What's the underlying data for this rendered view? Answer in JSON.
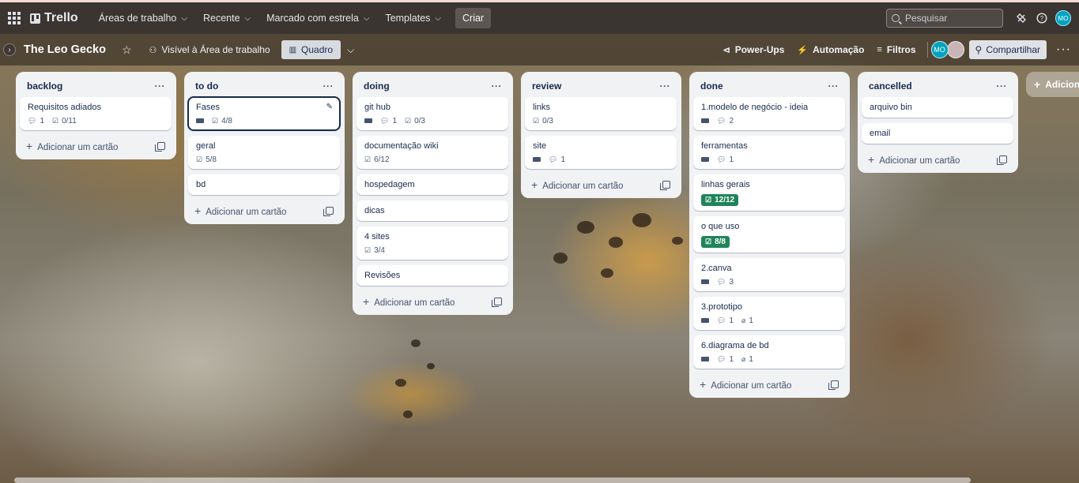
{
  "topbar": {
    "logo": "Trello",
    "menus": [
      "Áreas de trabalho",
      "Recente",
      "Marcado com estrela",
      "Templates"
    ],
    "create_label": "Criar",
    "search_placeholder": "Pesquisar",
    "avatar_initials": "MO"
  },
  "board": {
    "title": "The Leo Gecko",
    "visibility_label": "Visível à Área de trabalho",
    "view_label": "Quadro",
    "powerups_label": "Power-Ups",
    "automation_label": "Automação",
    "filters_label": "Filtros",
    "member_initials": "MO",
    "share_label": "Compartilhar",
    "add_card_label": "Adicionar um cartão",
    "add_list_label": "Adicionar outra lista"
  },
  "lists": [
    {
      "title": "backlog",
      "cards": [
        {
          "title": "Requisitos adiados",
          "comments": "1",
          "checklist": "0/11"
        }
      ]
    },
    {
      "title": "to do",
      "cards": [
        {
          "title": "Fases",
          "checklist": "4/8"
        },
        {
          "title": "geral",
          "checklist": "5/8"
        },
        {
          "title": "bd"
        }
      ]
    },
    {
      "title": "doing",
      "cards": [
        {
          "title": "git hub",
          "comments": "1",
          "checklist": "0/3"
        },
        {
          "title": "documentação wiki",
          "checklist": "6/12"
        },
        {
          "title": "hospedagem"
        },
        {
          "title": "dicas"
        },
        {
          "title": "4 sites",
          "checklist": "3/4"
        },
        {
          "title": "Revisões"
        }
      ]
    },
    {
      "title": "review",
      "cards": [
        {
          "title": "links",
          "checklist": "0/3"
        },
        {
          "title": "site",
          "comments": "1"
        }
      ]
    },
    {
      "title": "done",
      "cards": [
        {
          "title": "1.modelo de negócio - ideia",
          "comments": "2"
        },
        {
          "title": "ferramentas",
          "comments": "1"
        },
        {
          "title": "linhas gerais",
          "checklist": "12/12"
        },
        {
          "title": "o que uso",
          "checklist": "8/8"
        },
        {
          "title": "2.canva",
          "comments": "3"
        },
        {
          "title": "3.prototipo",
          "comments": "1",
          "attachments": "1"
        },
        {
          "title": "6.diagrama de bd",
          "comments": "1",
          "attachments": "1"
        }
      ]
    },
    {
      "title": "cancelled",
      "cards": [
        {
          "title": "arquivo bin"
        },
        {
          "title": "email"
        }
      ]
    }
  ],
  "colors": {
    "topbar": "#3b3531",
    "list_bg": "#f1f2f4",
    "complete_badge": "#1f845a",
    "avatar": "#00a3bf"
  }
}
